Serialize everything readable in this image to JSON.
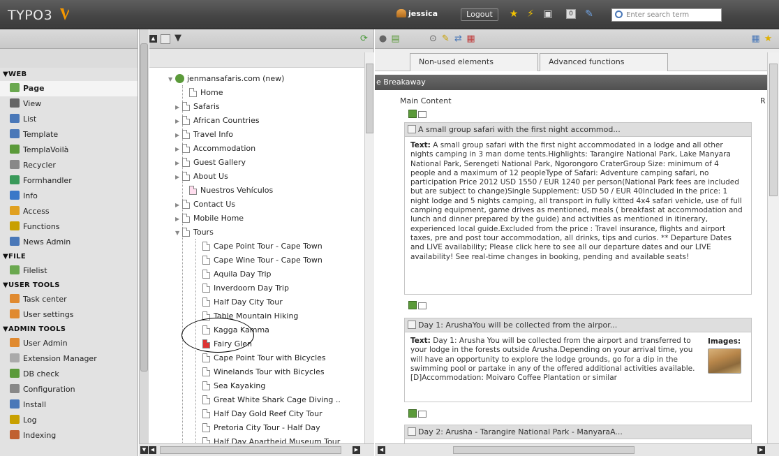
{
  "topbar": {
    "logo_text": "TYPO3",
    "username": "jessica",
    "logout_label": "Logout",
    "search_placeholder": "Enter search term",
    "badge_count": "0",
    "icons": [
      "star-icon",
      "lightning-icon",
      "clipboard-icon",
      "counter-icon",
      "edit-icon",
      "search-icon"
    ]
  },
  "sidebar": {
    "groups": [
      {
        "label": "▼WEB",
        "items": [
          {
            "label": "Page",
            "icon": "page-module-icon",
            "active": true
          },
          {
            "label": "View",
            "icon": "eye-icon"
          },
          {
            "label": "List",
            "icon": "list-icon"
          },
          {
            "label": "Template",
            "icon": "template-icon"
          },
          {
            "label": "TemplaVoilà",
            "icon": "templavoila-icon"
          },
          {
            "label": "Recycler",
            "icon": "recycler-icon"
          },
          {
            "label": "Formhandler",
            "icon": "formhandler-icon"
          },
          {
            "label": "Info",
            "icon": "info-icon"
          },
          {
            "label": "Access",
            "icon": "lock-icon"
          },
          {
            "label": "Functions",
            "icon": "wand-icon"
          },
          {
            "label": "News Admin",
            "icon": "news-icon"
          }
        ]
      },
      {
        "label": "▼FILE",
        "items": [
          {
            "label": "Filelist",
            "icon": "folder-icon"
          }
        ]
      },
      {
        "label": "▼USER TOOLS",
        "items": [
          {
            "label": "Task center",
            "icon": "task-icon"
          },
          {
            "label": "User settings",
            "icon": "user-settings-icon"
          }
        ]
      },
      {
        "label": "▼ADMIN TOOLS",
        "items": [
          {
            "label": "User Admin",
            "icon": "user-admin-icon"
          },
          {
            "label": "Extension Manager",
            "icon": "extension-icon"
          },
          {
            "label": "DB check",
            "icon": "db-icon"
          },
          {
            "label": "Configuration",
            "icon": "configuration-icon"
          },
          {
            "label": "Install",
            "icon": "install-icon"
          },
          {
            "label": "Log",
            "icon": "log-icon"
          },
          {
            "label": "Indexing",
            "icon": "indexing-icon"
          }
        ]
      }
    ]
  },
  "tree": {
    "root": "jenmansafaris.com (new)",
    "nodes": [
      "Home",
      "Safaris",
      "African Countries",
      "Travel Info",
      "Accommodation",
      "Guest Gallery",
      "About Us",
      "Nuestros Vehículos",
      "Contact Us",
      "Mobile Home",
      "Tours"
    ],
    "tours": [
      "Cape Point Tour - Cape Town",
      "Cape Wine Tour - Cape Town",
      "Aquila Day Trip",
      "Inverdoorn Day Trip",
      "Half Day City Tour",
      "Table Mountain Hiking",
      "Kagga Kamma",
      "Fairy Glen",
      "Cape Point Tour with Bicycles",
      "Winelands Tour with Bicycles",
      "Sea Kayaking",
      "Great White Shark Cage Diving ..",
      "Half Day Gold Reef City Tour",
      "Pretoria City Tour - Half Day",
      "Half Day Apartheid Museum Tour"
    ]
  },
  "content": {
    "tabs": [
      "Non-used elements",
      "Advanced functions"
    ],
    "section_title": "e Breakaway",
    "column_title": "Main Content",
    "column_right": "R",
    "elements": [
      {
        "header": "A small group safari with the first night accommod...",
        "label": "Text:",
        "body": " A small group safari with the first night accommodated in a lodge and all other nights camping in 3 man dome tents.Highlights: Tarangire National Park, Lake Manyara National Park, Serengeti National Park, Ngorongoro CraterGroup Size: minimum of 4 people and a maximum of 12 peopleType of Safari: Adventure camping safari, no participation Price 2012 USD 1550 / EUR 1240 per person(National Park fees are included but are subject to change)Single Supplement: USD 50 / EUR 40Included in the price: 1 night lodge and 5 nights camping, all transport in fully kitted 4x4 safari vehicle, use of full camping equipment, game drives as mentioned, meals ( breakfast at accommodation and lunch and dinner prepared by the guide) and activities as mentioned in itinerary, experienced local guide.Excluded from the price : Travel insurance, flights and airport taxes, pre and post tour accommodation, all drinks, tips and curios. ** Departure Dates and LIVE availability; Please click here to see all our departure dates and our LIVE availability! See real-time changes in booking, pending and available seats!"
      },
      {
        "header": "Day 1: ArushaYou will be collected from the airpor...",
        "label": "Text:",
        "body": " Day 1: Arusha You will be collected from the airport and transferred to your lodge in the forests outside Arusha.Depending on your arrival time, you will have an opportunity to explore the lodge grounds, go for a dip in the swimming pool or partake in any of the offered additional activities available. [D]Accommodation: Moivaro Coffee Plantation or similar",
        "images_label": "Images:"
      },
      {
        "header": "Day 2: Arusha - Tarangire National Park - ManyaraA..."
      }
    ]
  }
}
